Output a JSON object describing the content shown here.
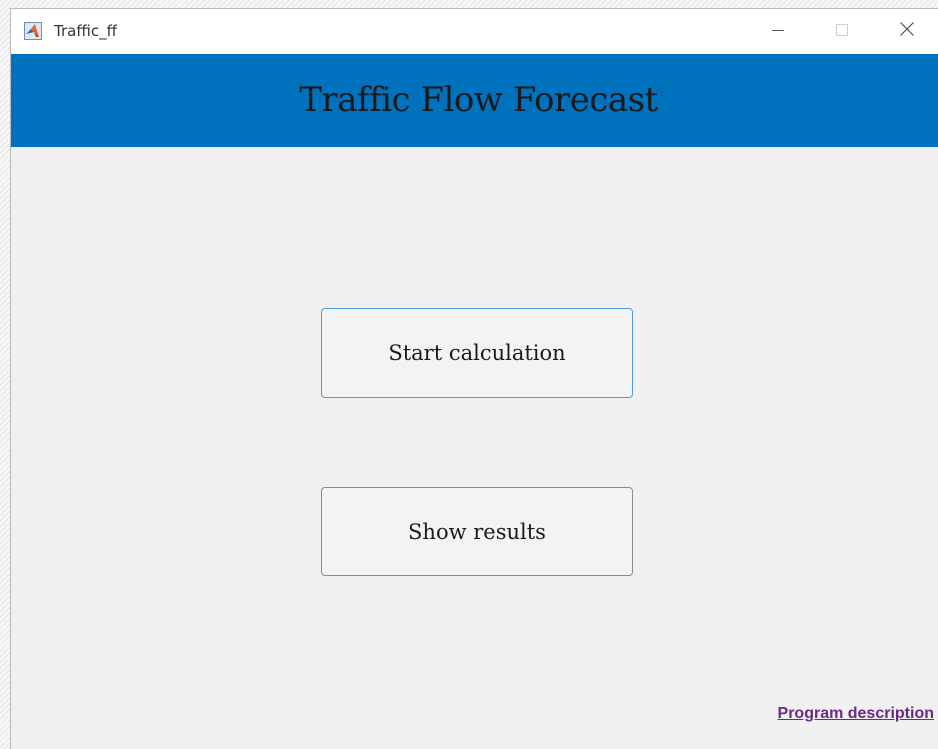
{
  "window": {
    "title": "Traffic_ff",
    "controls": {
      "minimize": "minimize-icon",
      "maximize": "maximize-icon",
      "close": "close-icon"
    }
  },
  "header": {
    "title": "Traffic Flow Forecast",
    "background_color": "#0072bd"
  },
  "buttons": {
    "start_label": "Start calculation",
    "show_label": "Show results"
  },
  "footer": {
    "link_label": "Program description",
    "link_color": "#6b2a86"
  },
  "colors": {
    "focus_border": "#4a9be0"
  }
}
